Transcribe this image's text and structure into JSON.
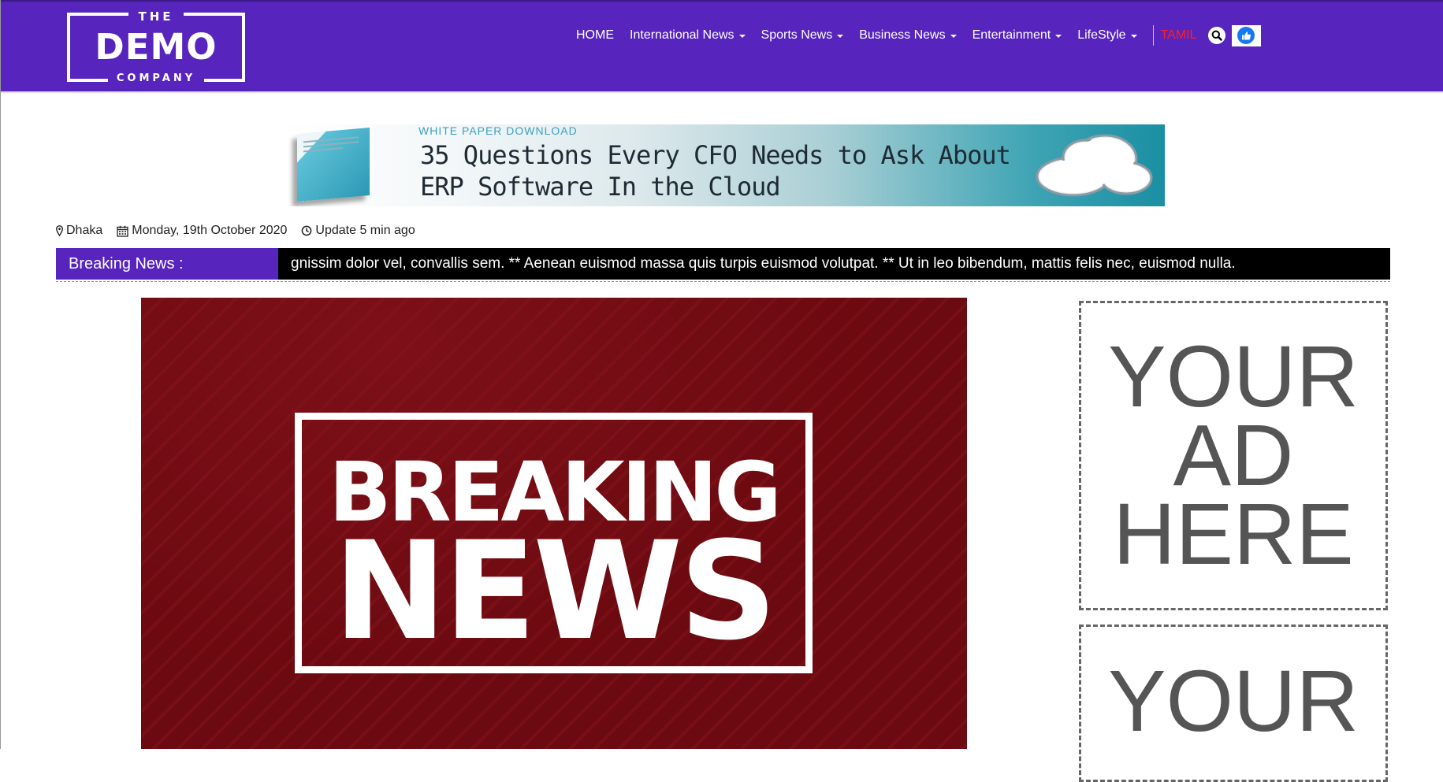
{
  "header": {
    "logo": {
      "the": "THE",
      "demo": "DEMO",
      "company": "COMPANY"
    },
    "nav": [
      {
        "label": "HOME",
        "dropdown": false
      },
      {
        "label": "International News",
        "dropdown": true
      },
      {
        "label": "Sports News",
        "dropdown": true
      },
      {
        "label": "Business News",
        "dropdown": true
      },
      {
        "label": "Entertainment",
        "dropdown": true
      },
      {
        "label": "LifeStyle",
        "dropdown": true
      }
    ],
    "language_link": "TAMIL",
    "icons": [
      "search-icon",
      "facebook-like-icon"
    ],
    "colors": {
      "brand": "#5724bd",
      "language_link": "#ff2020"
    }
  },
  "banner_ad": {
    "eyebrow": "WHITE PAPER DOWNLOAD",
    "line1": "35 Questions Every CFO Needs to Ask About",
    "line2": "ERP Software In the Cloud"
  },
  "meta": {
    "location": "Dhaka",
    "date": "Monday, 19th October 2020",
    "update": "Update 5 min ago"
  },
  "ticker": {
    "label": "Breaking News :",
    "text": "gnissim dolor vel, convallis sem. ** Aenean euismod massa quis turpis euismod volutpat. ** Ut in leo bibendum, mattis felis nec, euismod nulla."
  },
  "hero": {
    "line1": "BREAKING",
    "line2": "NEWS"
  },
  "ads": [
    {
      "lines": [
        "YOUR",
        "AD",
        "HERE"
      ]
    },
    {
      "lines": [
        "YOUR"
      ]
    }
  ]
}
